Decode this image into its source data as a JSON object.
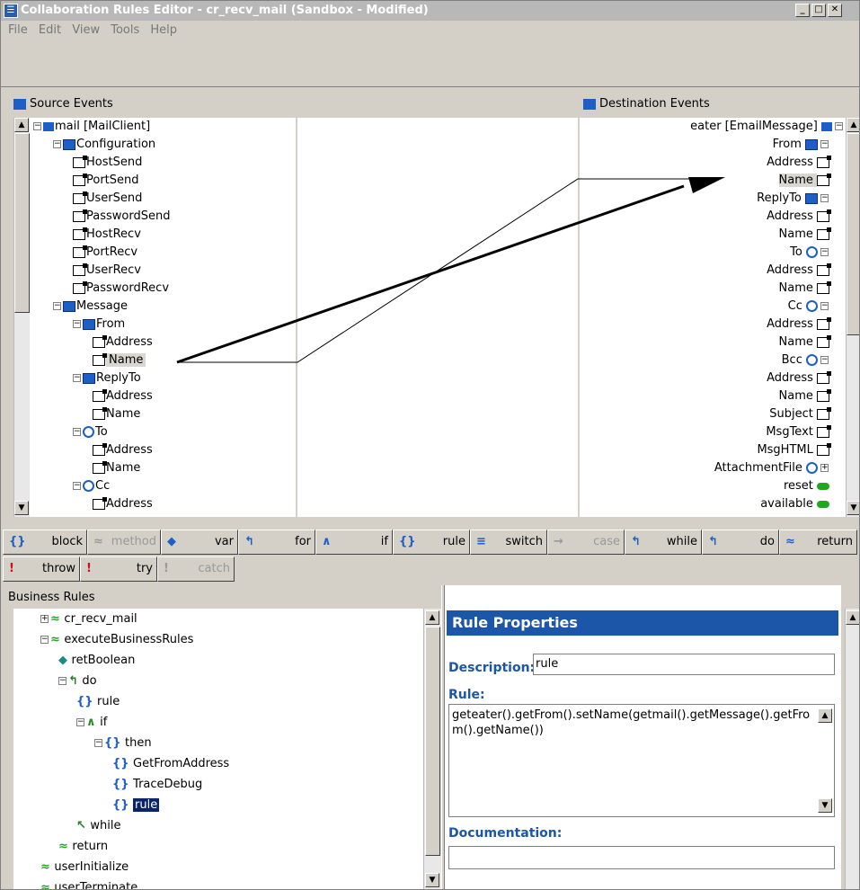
{
  "window": {
    "title": "Collaboration Rules Editor - cr_recv_mail (Sandbox - Modified)"
  },
  "menu": [
    "File",
    "Edit",
    "View",
    "Tools",
    "Help"
  ],
  "source": {
    "header": "Source Events",
    "items": [
      {
        "label": "mail [MailClient]",
        "icon": "root-icon"
      },
      {
        "label": "Configuration",
        "icon": "folder-icon"
      },
      {
        "label": "HostSend",
        "icon": "field-icon"
      },
      {
        "label": "PortSend",
        "icon": "field-icon"
      },
      {
        "label": "UserSend",
        "icon": "field-icon"
      },
      {
        "label": "PasswordSend",
        "icon": "field-icon"
      },
      {
        "label": "HostRecv",
        "icon": "field-icon"
      },
      {
        "label": "PortRecv",
        "icon": "field-icon"
      },
      {
        "label": "UserRecv",
        "icon": "field-icon"
      },
      {
        "label": "PasswordRecv",
        "icon": "field-icon"
      },
      {
        "label": "Message",
        "icon": "folder-icon"
      },
      {
        "label": "From",
        "icon": "folder-icon"
      },
      {
        "label": "Address",
        "icon": "field-icon"
      },
      {
        "label": "Name",
        "icon": "field-icon"
      },
      {
        "label": "ReplyTo",
        "icon": "folder-icon"
      },
      {
        "label": "Address",
        "icon": "field-icon"
      },
      {
        "label": "Name",
        "icon": "field-icon"
      },
      {
        "label": "To",
        "icon": "cycle-icon"
      },
      {
        "label": "Address",
        "icon": "field-icon"
      },
      {
        "label": "Name",
        "icon": "field-icon"
      },
      {
        "label": "Cc",
        "icon": "cycle-icon"
      },
      {
        "label": "Address",
        "icon": "field-icon"
      }
    ]
  },
  "destination": {
    "header": "Destination Events",
    "items": [
      {
        "label": "eater [EmailMessage]",
        "icon": "root-icon"
      },
      {
        "label": "From",
        "icon": "folder-icon"
      },
      {
        "label": "Address",
        "icon": "field-icon"
      },
      {
        "label": "Name",
        "icon": "field-icon"
      },
      {
        "label": "ReplyTo",
        "icon": "folder-icon"
      },
      {
        "label": "Address",
        "icon": "field-icon"
      },
      {
        "label": "Name",
        "icon": "field-icon"
      },
      {
        "label": "To",
        "icon": "cycle-icon"
      },
      {
        "label": "Address",
        "icon": "field-icon"
      },
      {
        "label": "Name",
        "icon": "field-icon"
      },
      {
        "label": "Cc",
        "icon": "cycle-icon"
      },
      {
        "label": "Address",
        "icon": "field-icon"
      },
      {
        "label": "Name",
        "icon": "field-icon"
      },
      {
        "label": "Bcc",
        "icon": "cycle-icon"
      },
      {
        "label": "Address",
        "icon": "field-icon"
      },
      {
        "label": "Name",
        "icon": "field-icon"
      },
      {
        "label": "Subject",
        "icon": "field-icon"
      },
      {
        "label": "MsgText",
        "icon": "field-icon"
      },
      {
        "label": "MsgHTML",
        "icon": "field-icon"
      },
      {
        "label": "AttachmentFile",
        "icon": "cycle-icon"
      },
      {
        "label": "reset",
        "icon": "method-icon"
      },
      {
        "label": "available",
        "icon": "method-icon"
      }
    ]
  },
  "toolbar_row1": [
    {
      "label": "block",
      "icon": "{}",
      "enabled": true
    },
    {
      "label": "method",
      "icon": "≈",
      "enabled": false
    },
    {
      "label": "var",
      "icon": "◆",
      "enabled": true
    },
    {
      "label": "for",
      "icon": "↰",
      "enabled": true
    },
    {
      "label": "if",
      "icon": "∧",
      "enabled": true
    },
    {
      "label": "rule",
      "icon": "{}",
      "enabled": true
    },
    {
      "label": "switch",
      "icon": "≡",
      "enabled": true
    },
    {
      "label": "case",
      "icon": "→",
      "enabled": false
    },
    {
      "label": "while",
      "icon": "↰",
      "enabled": true
    },
    {
      "label": "do",
      "icon": "↰",
      "enabled": true
    },
    {
      "label": "return",
      "icon": "≈",
      "enabled": true
    }
  ],
  "toolbar_row2": [
    {
      "label": "throw",
      "icon": "!",
      "enabled": true
    },
    {
      "label": "try",
      "icon": "!",
      "enabled": true
    },
    {
      "label": "catch",
      "icon": "!",
      "enabled": false
    }
  ],
  "business_rules": {
    "header": "Business Rules",
    "items": [
      {
        "label": "cr_recv_mail"
      },
      {
        "label": "executeBusinessRules"
      },
      {
        "label": "retBoolean"
      },
      {
        "label": "do"
      },
      {
        "label": "rule"
      },
      {
        "label": "if"
      },
      {
        "label": "then"
      },
      {
        "label": "GetFromAddress"
      },
      {
        "label": "TraceDebug"
      },
      {
        "label": "rule"
      },
      {
        "label": "while"
      },
      {
        "label": "return"
      },
      {
        "label": "userInitialize"
      },
      {
        "label": "userTerminate"
      }
    ]
  },
  "rule_properties": {
    "title": "Rule Properties",
    "description_label": "Description:",
    "description_value": "rule",
    "rule_label": "Rule:",
    "rule_text": "geteater().getFrom().setName(getmail().getMessage().getFrom().getName())",
    "documentation_label": "Documentation:",
    "documentation_value": ""
  }
}
